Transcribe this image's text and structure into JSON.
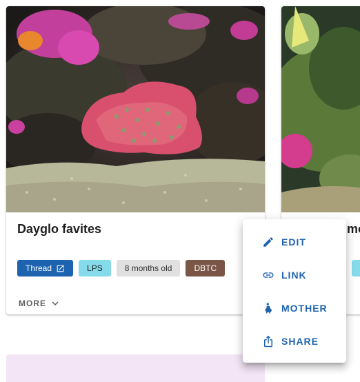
{
  "card1": {
    "title": "Dayglo favites",
    "chips": {
      "thread": "Thread",
      "type": "LPS",
      "age": "8 months old",
      "method": "DBTC"
    },
    "more_label": "MORE"
  },
  "card2": {
    "title_partial": "mo"
  },
  "menu": {
    "items": [
      {
        "label": "EDIT",
        "icon": "pencil-icon"
      },
      {
        "label": "LINK",
        "icon": "link-icon"
      },
      {
        "label": "MOTHER",
        "icon": "mother-icon"
      },
      {
        "label": "SHARE",
        "icon": "share-icon"
      }
    ]
  },
  "colors": {
    "primary": "#1e63b0",
    "lps_chip": "#86dbea",
    "age_chip": "#e0e0e0",
    "dbtc_chip": "#7b5545",
    "card3_bg": "#f3e5f5"
  }
}
